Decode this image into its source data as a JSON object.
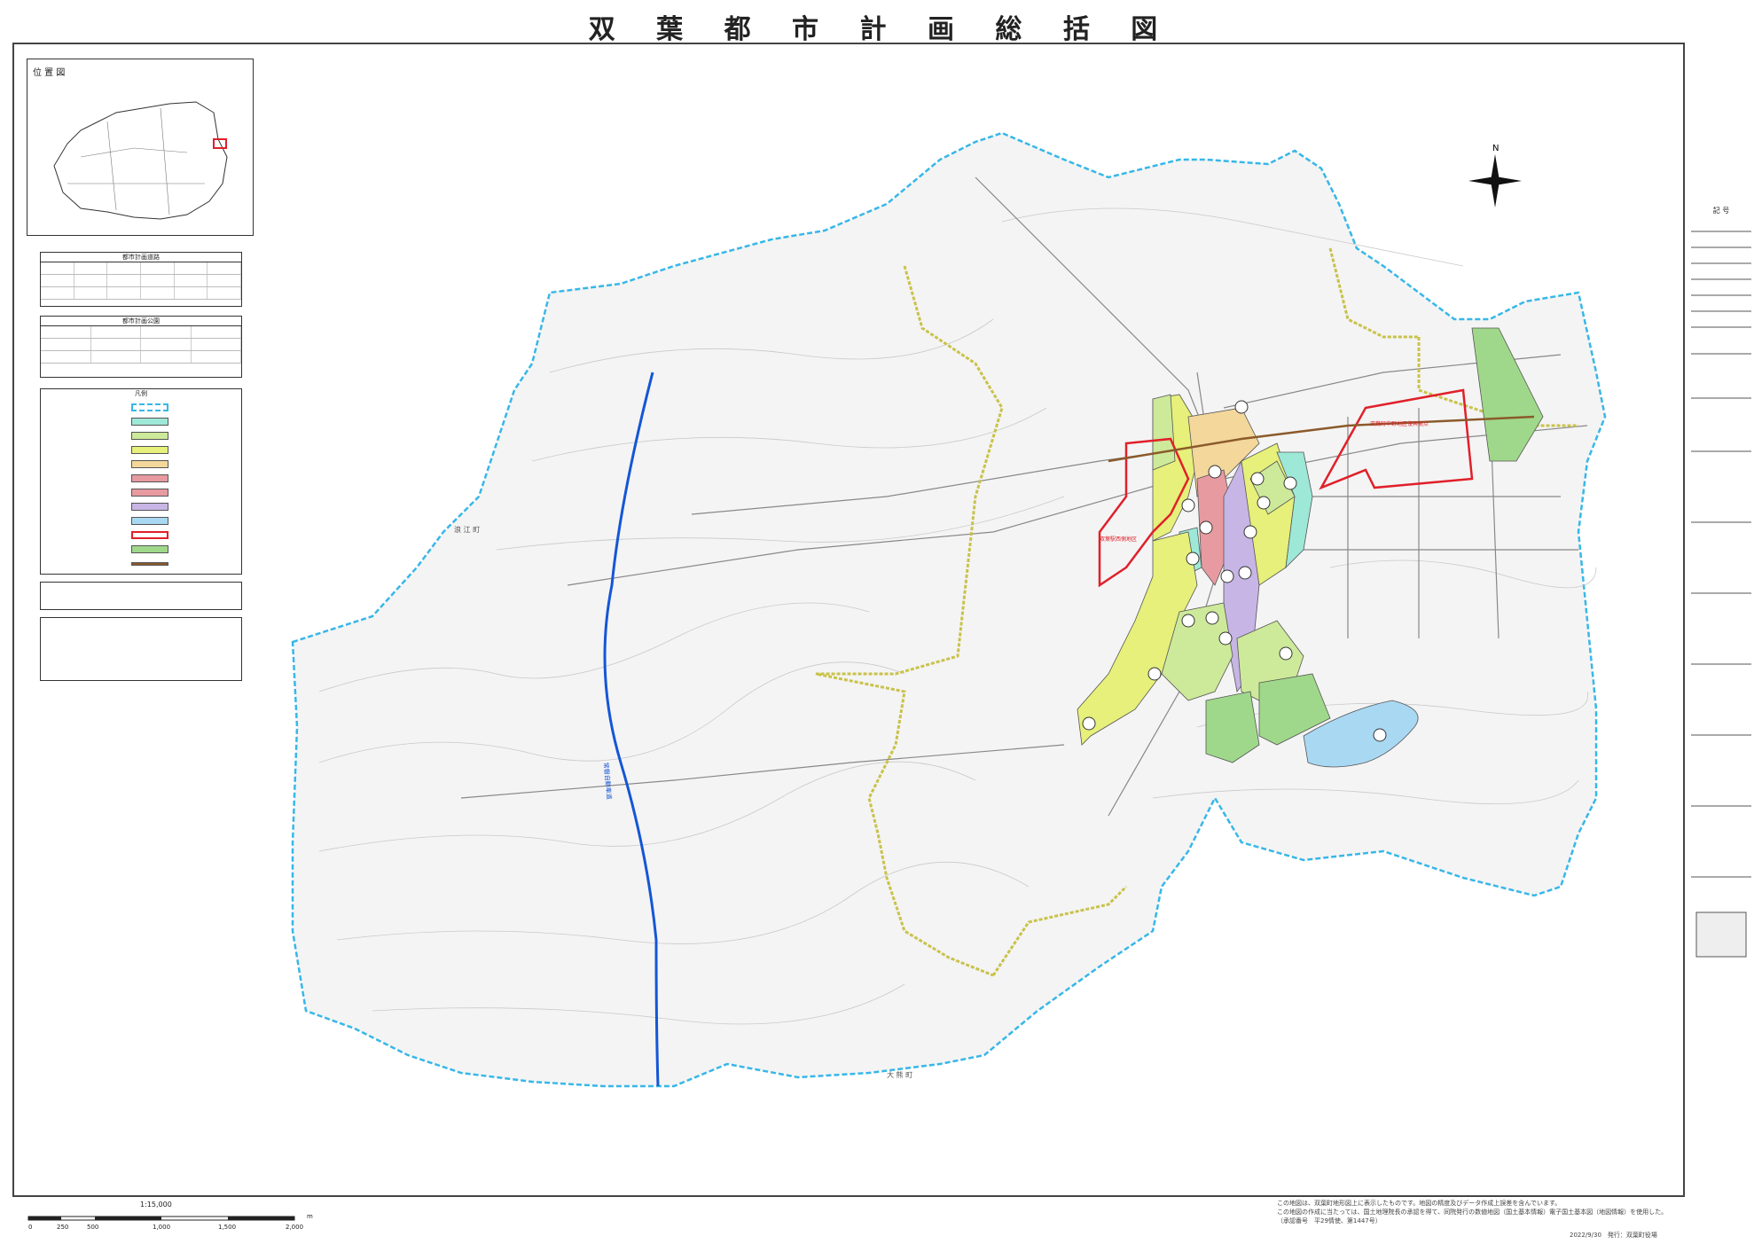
{
  "title": "双 葉 都 市 計 画 総 括 図",
  "inset": {
    "heading": "位 置 図"
  },
  "tables": {
    "t1_title": "都市計画道路",
    "t2_title": "都市計画公園",
    "t3_title": "凡例"
  },
  "map": {
    "north": "N",
    "town_label": "浪 江 町",
    "town_label_south": "大 熊 町",
    "road_label": "常磐自動車道",
    "red_label_1": "双葉町中野地区復興拠点",
    "red_label_2": "双葉駅西側地区"
  },
  "right_legend": {
    "title": "記 号"
  },
  "scale": {
    "label": "1:15,000",
    "ticks": [
      "0",
      "250",
      "500",
      "1,000",
      "1,500",
      "2,000"
    ],
    "unit": "m"
  },
  "credit": {
    "line1": "この地図は、双葉町地形図上に表示したものです。地図の精度及びデータ作成上誤差を含んでいます。",
    "line2": "この地図の作成に当たっては、国土地理院長の承認を得て、同院発行の数値地図（国土基本情報）電子国土基本図（地図情報）を使用した。",
    "line3": "（承認番号　平29情使、第1447号）",
    "date": "2022/9/30　発行：双葉町役場"
  },
  "colors": {
    "zone_yellow": "#e6f07a",
    "zone_light_green": "#cde99a",
    "zone_green": "#9fd88a",
    "zone_orange": "#f3d79b",
    "zone_pink": "#e79aa0",
    "zone_purple": "#c7b5e6",
    "zone_cyan": "#9ee8d8",
    "zone_blue": "#a9d8f3",
    "boundary_cyan": "#37b7e8",
    "boundary_yellow": "#c9c24a",
    "expressway": "#1456d6",
    "red_area": "#e0202a"
  }
}
